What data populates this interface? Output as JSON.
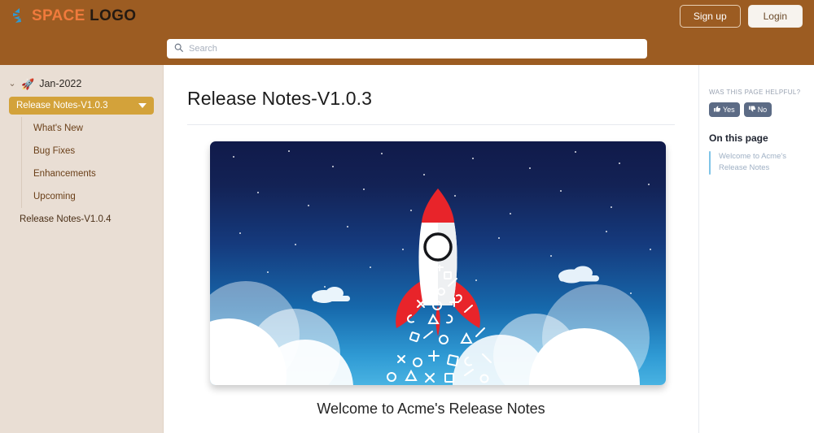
{
  "header": {
    "brand_space": "SPACE",
    "brand_logo": "LOGO",
    "brand_mark_icon": "spark-burst-icon",
    "signup_label": "Sign up",
    "login_label": "Login"
  },
  "search": {
    "icon": "search-icon",
    "placeholder": "Search",
    "value": ""
  },
  "sidebar": {
    "group": {
      "chevron_icon": "chevron-down-icon",
      "emoji": "🚀",
      "label": "Jan-2022"
    },
    "active_item": {
      "label": "Release Notes-V1.0.3",
      "caret_icon": "caret-down-icon"
    },
    "sub_items": [
      {
        "label": "What's New"
      },
      {
        "label": "Bug Fixes"
      },
      {
        "label": "Enhancements"
      },
      {
        "label": "Upcoming"
      }
    ],
    "items": [
      {
        "label": "Release Notes-V1.0.4"
      }
    ]
  },
  "main": {
    "title": "Release Notes-V1.0.3",
    "hero_alt": "rocket-launch-illustration",
    "caption": "Welcome to Acme's Release Notes"
  },
  "right_panel": {
    "helpful_label": "WAS THIS PAGE HELPFUL?",
    "yes_label": "Yes",
    "yes_icon": "thumbs-up-icon",
    "no_label": "No",
    "no_icon": "thumbs-down-icon",
    "on_this_page_title": "On this page",
    "toc": [
      {
        "label": "Welcome to Acme's Release Notes"
      }
    ]
  },
  "colors": {
    "header_brown": "#9c5c22",
    "brand_orange": "#f07a3c",
    "sidebar_beige": "#e9ded4",
    "active_gold": "#d3a23a",
    "vote_slate": "#5c6b85",
    "toc_accent": "#7fc4e8"
  }
}
